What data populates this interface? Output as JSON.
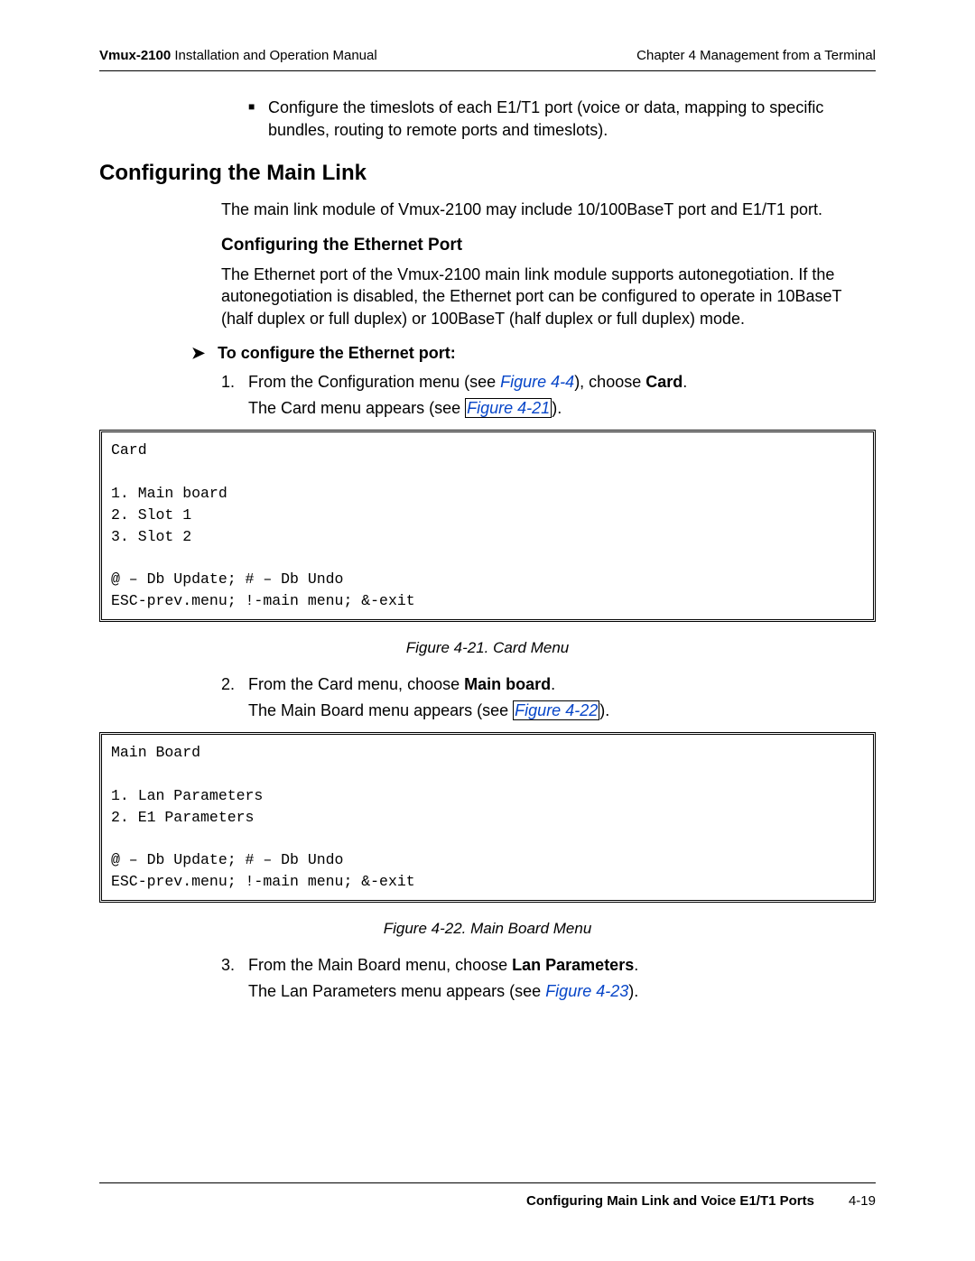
{
  "header": {
    "product": "Vmux-2100",
    "doc": "Installation and Operation Manual",
    "chapter": "Chapter 4  Management from a Terminal"
  },
  "bullet_intro": "Configure the timeslots of each E1/T1 port (voice or data, mapping to specific bundles, routing to remote ports and timeslots).",
  "section_h1": "Configuring the Main Link",
  "section_intro": "The main link module of Vmux-2100 may include 10/100BaseT port and E1/T1 port.",
  "sub_h2": "Configuring the Ethernet Port",
  "sub_text": "The Ethernet port of the Vmux-2100 main link module supports autonegotiation. If the autonegotiation is disabled, the Ethernet port can be configured to operate in 10BaseT (half duplex or full duplex) or 100BaseT (half duplex or full duplex) mode.",
  "procedure_title": "To configure the Ethernet port:",
  "steps": {
    "s1": {
      "num": "1.",
      "pre": "From the Configuration menu (see ",
      "link": "Figure 4-4",
      "mid": "), choose ",
      "bold": "Card",
      "post": ".",
      "result_pre": "The Card menu appears (see ",
      "result_link": "Figure 4-21",
      "result_post": ")."
    },
    "s2": {
      "num": "2.",
      "pre": "From the Card menu, choose ",
      "bold": "Main board",
      "post": ".",
      "result_pre": "The Main Board menu appears (see ",
      "result_link": "Figure 4-22",
      "result_post": ")."
    },
    "s3": {
      "num": "3.",
      "pre": "From the Main Board menu, choose ",
      "bold": "Lan Parameters",
      "post": ".",
      "result_pre": "The Lan Parameters menu appears (see ",
      "result_link": "Figure 4-23",
      "result_post": ")."
    }
  },
  "code1": "Card\n\n1. Main board\n2. Slot 1\n3. Slot 2\n\n@ – Db Update; # – Db Undo\nESC-prev.menu; !-main menu; &-exit",
  "caption1": "Figure 4-21.  Card Menu",
  "code2": "Main Board\n\n1. Lan Parameters\n2. E1 Parameters\n\n@ – Db Update; # – Db Undo\nESC-prev.menu; !-main menu; &-exit",
  "caption2": "Figure 4-22.  Main Board Menu",
  "footer": {
    "section": "Configuring Main Link and Voice E1/T1 Ports",
    "page": "4-19"
  }
}
